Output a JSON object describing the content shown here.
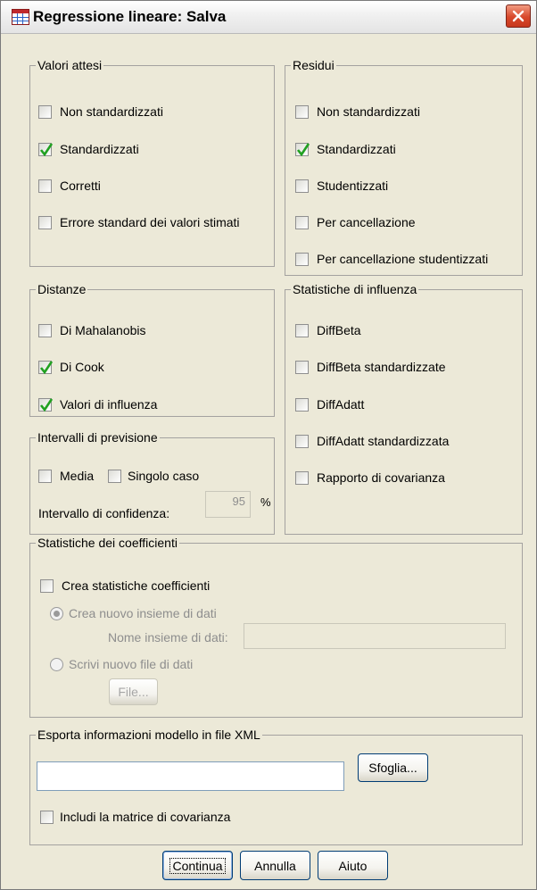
{
  "window": {
    "title": "Regressione lineare: Salva"
  },
  "groups": {
    "valori_attesi": {
      "title": "Valori attesi",
      "items": [
        {
          "label": "Non standardizzati",
          "checked": false
        },
        {
          "label": "Standardizzati",
          "checked": true
        },
        {
          "label": "Corretti",
          "checked": false
        },
        {
          "label": "Errore standard dei valori stimati",
          "checked": false
        }
      ]
    },
    "residui": {
      "title": "Residui",
      "items": [
        {
          "label": "Non standardizzati",
          "checked": false
        },
        {
          "label": "Standardizzati",
          "checked": true
        },
        {
          "label": "Studentizzati",
          "checked": false
        },
        {
          "label": "Per cancellazione",
          "checked": false
        },
        {
          "label": "Per cancellazione studentizzati",
          "checked": false
        }
      ]
    },
    "distanze": {
      "title": "Distanze",
      "items": [
        {
          "label": "Di Mahalanobis",
          "checked": false
        },
        {
          "label": "Di Cook",
          "checked": true
        },
        {
          "label": "Valori di influenza",
          "checked": true
        }
      ]
    },
    "influenza": {
      "title": "Statistiche di influenza",
      "items": [
        {
          "label": "DiffBeta",
          "checked": false
        },
        {
          "label": "DiffBeta standardizzate",
          "checked": false
        },
        {
          "label": "DiffAdatt",
          "checked": false
        },
        {
          "label": "DiffAdatt standardizzata",
          "checked": false
        },
        {
          "label": "Rapporto di covarianza",
          "checked": false
        }
      ]
    },
    "intervalli": {
      "title": "Intervalli di previsione",
      "media": "Media",
      "singolo": "Singolo caso",
      "confidenza_label": "Intervallo di confidenza:",
      "confidenza_value": "95",
      "percent": "%"
    },
    "coefficienti": {
      "title": "Statistiche dei coefficienti",
      "crea_label": "Crea statistiche coefficienti",
      "radio_nuovo": "Crea nuovo insieme di dati",
      "nome_label": "Nome insieme di dati:",
      "radio_file": "Scrivi nuovo file di dati",
      "file_button": "File..."
    },
    "esporta": {
      "title": "Esporta informazioni modello in file  XML",
      "path_value": "",
      "browse_button": "Sfoglia...",
      "includi_label": "Includi la matrice di covarianza"
    }
  },
  "buttons": {
    "continua": "Continua",
    "annulla": "Annulla",
    "aiuto": "Aiuto"
  }
}
